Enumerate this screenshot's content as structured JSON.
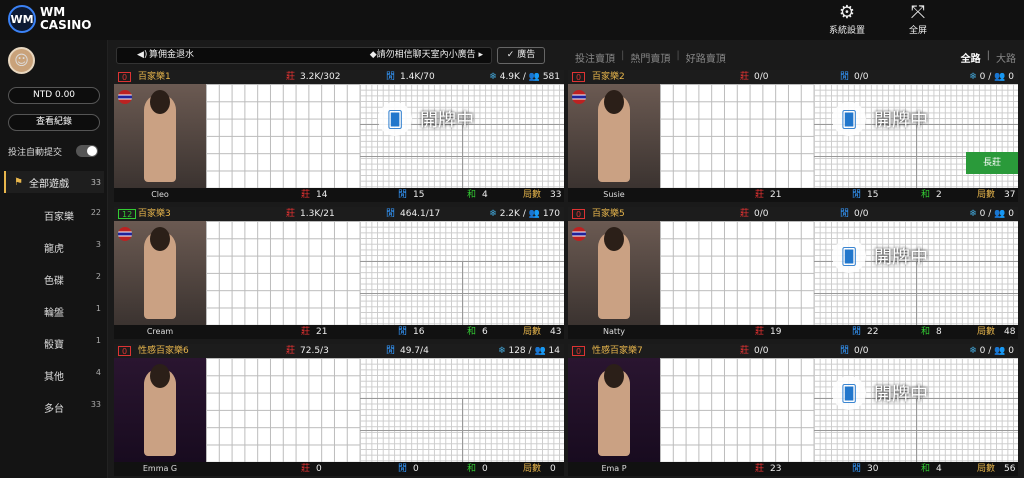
{
  "brand": {
    "mark": "WM",
    "line1": "WM",
    "line2": "CASINO"
  },
  "topbar": {
    "settings_label": "系統設置",
    "fullscreen_label": "全屏"
  },
  "user": {
    "balance": "NTD 0.00",
    "records_label": "查看紀錄",
    "auto_submit_label": "投注自動提交"
  },
  "categories": [
    {
      "label": "全部遊戲",
      "count": "33"
    },
    {
      "label": "百家樂",
      "count": "22"
    },
    {
      "label": "龍虎",
      "count": "3"
    },
    {
      "label": "色碟",
      "count": "2"
    },
    {
      "label": "輪盤",
      "count": "1"
    },
    {
      "label": "骰寶",
      "count": "1"
    },
    {
      "label": "其他",
      "count": "4"
    },
    {
      "label": "多台",
      "count": "33"
    }
  ],
  "news": {
    "left": "算佣金退水",
    "right": "◆請勿相信聊天室內小廣告 ▸"
  },
  "ad_label": "廣告",
  "tabs": [
    "投注賣頂",
    "熱門賣頂",
    "好路賣頂"
  ],
  "view_tabs": [
    "全路",
    "大路"
  ],
  "shuffle_text": "開牌中",
  "long_text": "長莊",
  "labels": {
    "banker": "莊",
    "player": "閒",
    "tie": "和",
    "rounds": "局數"
  },
  "tables": [
    {
      "num": "0",
      "name": "百家樂1",
      "banker": "3.2K/302",
      "player": "1.4K/70",
      "snow": "4.9K",
      "users": "581",
      "dealer": "Cleo",
      "b": "14",
      "p": "15",
      "t": "4",
      "r": "33",
      "state": "shuffle"
    },
    {
      "num": "0",
      "name": "百家樂2",
      "banker": "0/0",
      "player": "0/0",
      "snow": "0",
      "users": "0",
      "dealer": "Susie",
      "b": "21",
      "p": "15",
      "t": "2",
      "r": "37",
      "state": "shuffle-long"
    },
    {
      "num": "12",
      "name": "百家樂3",
      "banker": "1.3K/21",
      "player": "464.1/17",
      "snow": "2.2K",
      "users": "170",
      "dealer": "Cream",
      "b": "21",
      "p": "16",
      "t": "6",
      "r": "43",
      "state": "open"
    },
    {
      "num": "0",
      "name": "百家樂5",
      "banker": "0/0",
      "player": "0/0",
      "snow": "0",
      "users": "0",
      "dealer": "Natty",
      "b": "19",
      "p": "22",
      "t": "8",
      "r": "48",
      "state": "shuffle"
    },
    {
      "num": "0",
      "name": "性感百家樂6",
      "banker": "72.5/3",
      "player": "49.7/4",
      "snow": "128",
      "users": "14",
      "dealer": "Emma G",
      "b": "0",
      "p": "0",
      "t": "0",
      "r": "0",
      "state": "empty"
    },
    {
      "num": "0",
      "name": "性感百家樂7",
      "banker": "0/0",
      "player": "0/0",
      "snow": "0",
      "users": "0",
      "dealer": "Ema P",
      "b": "23",
      "p": "30",
      "t": "4",
      "r": "56",
      "state": "shuffle"
    }
  ]
}
